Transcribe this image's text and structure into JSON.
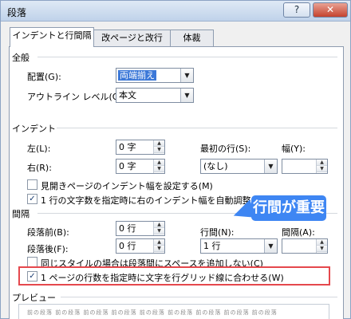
{
  "window": {
    "title": "段落",
    "help_label": "?",
    "close_label": "✕"
  },
  "tabs": [
    {
      "label": "インデントと行間隔"
    },
    {
      "label": "改ページと改行"
    },
    {
      "label": "体裁"
    }
  ],
  "general": {
    "section": "全般",
    "alignment_label": "配置(G):",
    "alignment_value": "両端揃え",
    "outline_label": "アウトライン レベル(O):",
    "outline_value": "本文"
  },
  "indent": {
    "section": "インデント",
    "left_label": "左(L):",
    "left_value": "0 字",
    "right_label": "右(R):",
    "right_value": "0 字",
    "first_line_label": "最初の行(S):",
    "first_line_value": "(なし)",
    "width_label": "幅(Y):",
    "width_value": "",
    "mirror_label": "見開きページのインデント幅を設定する(M)",
    "auto_adjust_label": "1 行の文字数を指定時に右のインデント幅を自動調整する"
  },
  "spacing": {
    "section": "間隔",
    "before_label": "段落前(B):",
    "before_value": "0 行",
    "after_label": "段落後(F):",
    "after_value": "0 行",
    "line_spacing_label": "行間(N):",
    "line_spacing_value": "1 行",
    "at_label": "間隔(A):",
    "at_value": "",
    "no_space_label": "同じスタイルの場合は段落間にスペースを追加しない(C)",
    "snap_grid_label": "1 ページの行数を指定時に文字を行グリッド線に合わせる(W)"
  },
  "preview": {
    "section": "プレビュー",
    "sample_text": "前の段落 前の段落 前の段落 前の段落 前の段落 前の段落 前の段落 前の段落 前の段落"
  },
  "callout": {
    "text": "行間が重要"
  },
  "colors": {
    "accent": "#3e86f3",
    "highlight_border": "#e5484d",
    "selection": "#3b78d8"
  }
}
